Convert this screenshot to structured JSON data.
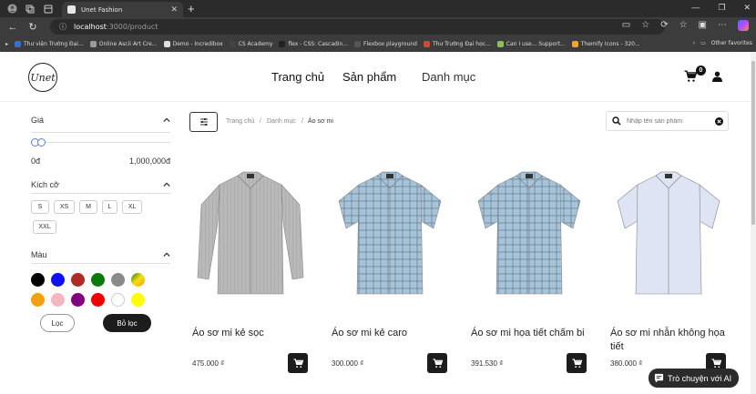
{
  "browser": {
    "tab_title": "Unet Fashion",
    "url_host": "localhost",
    "url_path": ":3000/product",
    "bookmarks": [
      {
        "label": "Thư viện Trường Đại...",
        "color": "#2f6fd6"
      },
      {
        "label": "Online Ascii Art Cre...",
        "color": "#9a9a9a"
      },
      {
        "label": "Demo - Incredibox",
        "color": "#e0e0e0"
      },
      {
        "label": "CS Academy",
        "color": "#444"
      },
      {
        "label": "flex - CSS: Cascadin...",
        "color": "#222"
      },
      {
        "label": "Flexbox playground",
        "color": "#555"
      },
      {
        "label": "Thư Trường Đại học...",
        "color": "#d44638"
      },
      {
        "label": "Can I use... Support...",
        "color": "#8bc34a"
      },
      {
        "label": "Themify Icons - 320...",
        "color": "#f5a623"
      }
    ],
    "other_favorites": "Other favorites"
  },
  "header": {
    "logo_text": "Unet",
    "nav": [
      "Trang chủ",
      "Sản phẩm",
      "Danh mục"
    ],
    "cart_count": "0"
  },
  "filters": {
    "price_title": "Giá",
    "price_min": "0đ",
    "price_max": "1,000,000đ",
    "size_title": "Kích cỡ",
    "sizes": [
      "S",
      "XS",
      "M",
      "L",
      "XL",
      "XXL"
    ],
    "color_title": "Màu",
    "colors": [
      "#000000",
      "#1010f0",
      "#b02a2a",
      "#0a7a0a",
      "#8a8a8a",
      "gradient",
      "#f5a010",
      "#f4b6c2",
      "#800080",
      "#f00000",
      "#ffffff",
      "#ffff00"
    ],
    "apply_label": "Lọc",
    "clear_label": "Bỏ lọc"
  },
  "breadcrumb": [
    "Trang chủ",
    "Danh mục",
    "Áo sơ mi"
  ],
  "search": {
    "placeholder": "Nhập tên sản phẩm"
  },
  "products": [
    {
      "name": "Áo sơ mi kẻ sọc",
      "price": "475.000 ₫",
      "image": "grey-long-sleeve-shirt"
    },
    {
      "name": "Áo sơ mi kẻ caro",
      "price": "300.000 ₫",
      "image": "blue-check-short-sleeve-shirt"
    },
    {
      "name": "Áo sơ mi họa tiết chấm bi",
      "price": "391.530 ₫",
      "image": "blue-check-short-sleeve-shirt"
    },
    {
      "name": "Áo sơ mi nhẫn không họa tiết",
      "price": "380.000 ₫",
      "image": "light-blue-short-sleeve-shirt"
    }
  ],
  "chat": {
    "label": "Trò chuyện với AI"
  }
}
